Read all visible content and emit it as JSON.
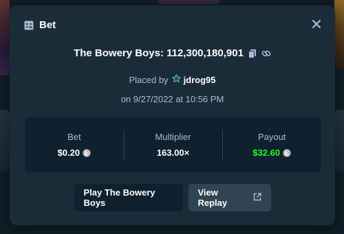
{
  "modal": {
    "header_title": "Bet",
    "game_title": "The Bowery Boys: 112,300,180,901",
    "placed_by_label": "Placed by",
    "username": "jdrog95",
    "date_text": "on 9/27/2022 at 10:56 PM"
  },
  "stats": {
    "bet_label": "Bet",
    "bet_value": "$0.20",
    "multiplier_label": "Multiplier",
    "multiplier_value": "163.00×",
    "payout_label": "Payout",
    "payout_value": "$32.60"
  },
  "actions": {
    "play_label": "Play The Bowery Boys",
    "replay_label": "View Replay"
  },
  "icons": {
    "header": "bet-slip-icon",
    "close": "close-icon",
    "copy": "copy-icon",
    "link": "link-icon",
    "vip": "star-badge-icon",
    "coin": "litecoin-icon",
    "external": "external-link-icon"
  },
  "colors": {
    "modal_bg": "#1a2c38",
    "panel_bg": "#0f212e",
    "muted_text": "#b1bad3",
    "payout_green": "#1fff20",
    "button_grey": "#2f4553"
  }
}
